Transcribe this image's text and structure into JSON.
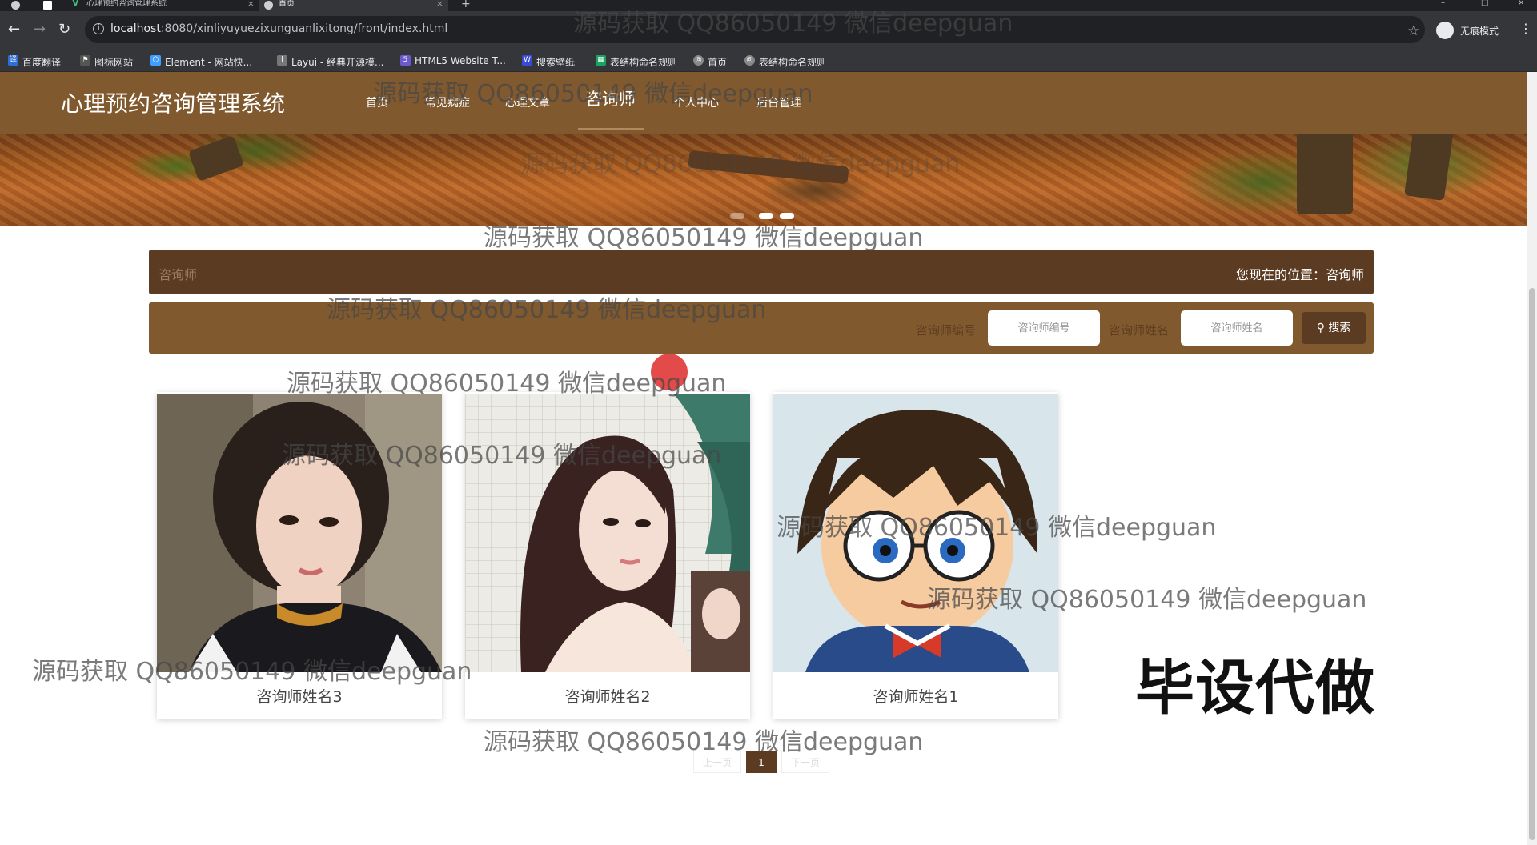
{
  "browser": {
    "tabs": [
      {
        "title": "心理预约咨询管理系统",
        "active": false
      },
      {
        "title": "首页",
        "active": true
      }
    ],
    "url_host": "localhost",
    "url_path": ":8080/xinliyuyuezixunguanlixitong/front/index.html",
    "profile_label": "无痕模式",
    "bookmarks": [
      {
        "label": "百度翻译",
        "icon": "translate-icon",
        "color": "#2b6fd6"
      },
      {
        "label": "图标网站",
        "icon": "flag-icon",
        "color": "#555555"
      },
      {
        "label": "Element - 网站快...",
        "icon": "element-icon",
        "color": "#409eff"
      },
      {
        "label": "Layui - 经典开源模...",
        "icon": "layui-icon",
        "color": "#777777"
      },
      {
        "label": "HTML5 Website T...",
        "icon": "html5-icon",
        "color": "#6a5acd"
      },
      {
        "label": "搜索壁纸",
        "icon": "wallpaper-icon",
        "color": "#3a4ad8"
      },
      {
        "label": "表结构命名规则",
        "icon": "sheet-icon",
        "color": "#1aa260"
      },
      {
        "label": "首页",
        "icon": "globe-icon",
        "color": "#888888"
      },
      {
        "label": "表结构命名规则",
        "icon": "globe-icon",
        "color": "#888888"
      }
    ]
  },
  "site": {
    "logo": "心理预约咨询管理系统",
    "nav": [
      "首页",
      "常见病症",
      "心理文章",
      "咨询师",
      "个人中心",
      "后台管理"
    ],
    "active_nav": "咨询师"
  },
  "breadcrumb": {
    "current": "咨询师",
    "position": "您现在的位置：咨询师"
  },
  "search": {
    "field1_label": "咨询师编号",
    "field1_placeholder": "咨询师编号",
    "field2_label": "咨询师姓名",
    "field2_placeholder": "咨询师姓名",
    "button": "搜索"
  },
  "cards": [
    {
      "name": "咨询师姓名3"
    },
    {
      "name": "咨询师姓名2"
    },
    {
      "name": "咨询师姓名1"
    }
  ],
  "pagination": {
    "prev": "上一页",
    "current": "1",
    "next": "下一页"
  },
  "overlay": {
    "watermark": "源码获取 QQ86050149 微信deepguan",
    "big_label": "毕设代做"
  },
  "colors": {
    "nav_bg": "#80592e",
    "accent_dark": "#5b3b22"
  }
}
